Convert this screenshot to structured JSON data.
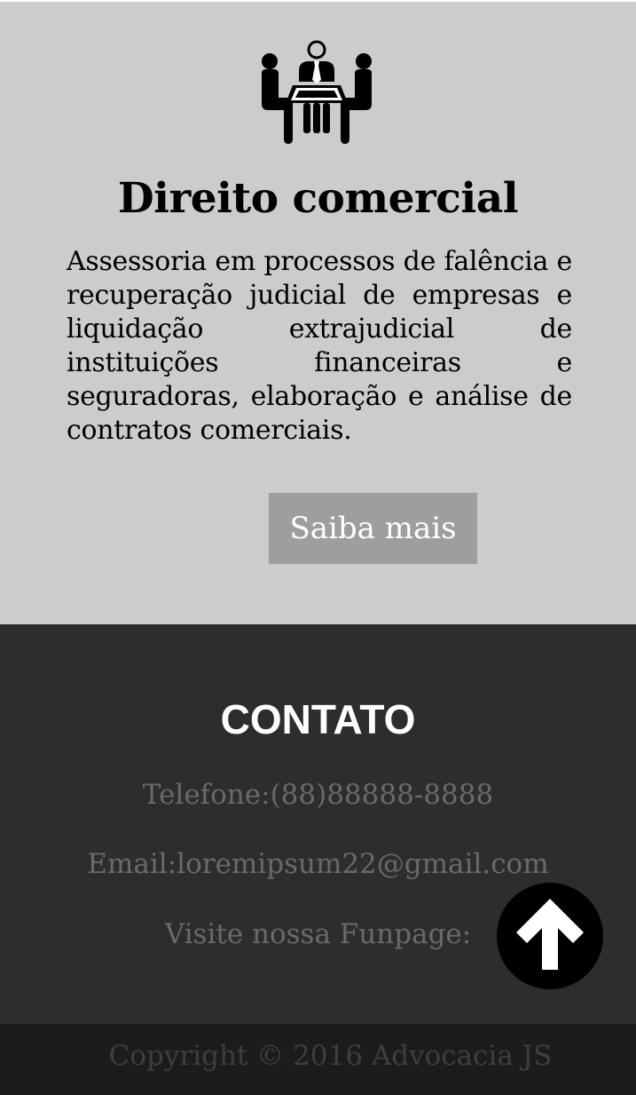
{
  "service": {
    "icon": "business-meeting-icon",
    "title": "Direito comercial",
    "description": "Assessoria em processos de falência e recuperação judicial de empresas e liquidação extrajudicial de instituições financeiras e seguradoras, elaboração e análise de contratos comerciais.",
    "button_label": "Saiba mais"
  },
  "contact": {
    "title": "CONTATO",
    "phone": "Telefone:(88)88888-8888",
    "email": "Email:loremipsum22@gmail.com",
    "fanpage": "Visite nossa Funpage:"
  },
  "scroll_top": {
    "icon": "arrow-up-icon"
  },
  "footer": {
    "copyright": "Copyright © 2016 Advocacia JS"
  },
  "colors": {
    "service_bg": "#cccccc",
    "button_bg": "#9e9e9e",
    "contact_bg": "#2d2d2d",
    "footer_bg": "#1c1c1c"
  }
}
